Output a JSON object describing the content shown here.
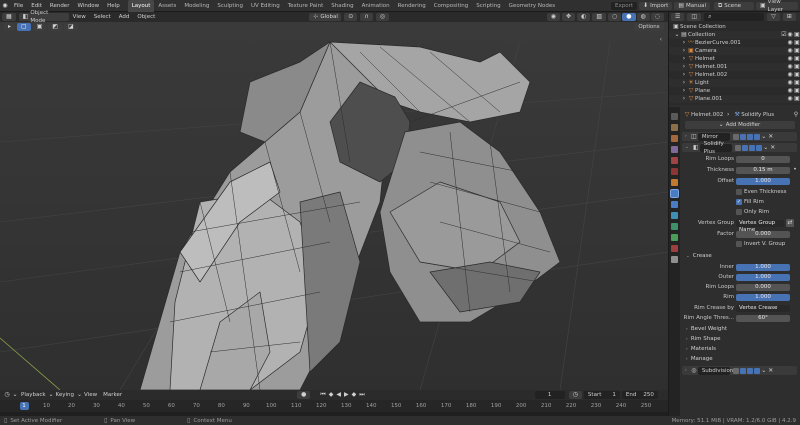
{
  "topbar": {
    "menus": [
      "File",
      "Edit",
      "Render",
      "Window",
      "Help"
    ],
    "workspaces": [
      "Layout",
      "Assets",
      "Modeling",
      "Sculpting",
      "UV Editing",
      "Texture Paint",
      "Shading",
      "Animation",
      "Rendering",
      "Compositing",
      "Scripting",
      "Geometry Nodes"
    ],
    "active_workspace": "Layout",
    "export_label": "Export",
    "import_label": "Import",
    "manual_label": "Manual",
    "scene": "Scene",
    "view_layer": "View Layer"
  },
  "viewport_header": {
    "mode": "Object Mode",
    "menus": [
      "View",
      "Select",
      "Add",
      "Object"
    ],
    "orientation": "Global",
    "options_label": "Options"
  },
  "outliner": {
    "root": "Scene Collection",
    "collection": "Collection",
    "items": [
      "BezierCurve.001",
      "Camera",
      "Helmet",
      "Helmet.001",
      "Helmet.002",
      "Light",
      "Plane",
      "Plane.001"
    ]
  },
  "properties": {
    "object_name": "Helmet.002",
    "modifier_name": "Solidify Plus",
    "add_modifier": "Add Modifier",
    "mirror_label": "Mirror",
    "solidify_label": "Solidify Plus",
    "rows": {
      "rim_loops": {
        "label": "Rim Loops",
        "value": "0"
      },
      "thickness": {
        "label": "Thickness",
        "value": "0.15 m"
      },
      "offset": {
        "label": "Offset",
        "value": "1.000"
      },
      "even_thickness": "Even Thickness",
      "fill_rim": "Fill Rim",
      "only_rim": "Only Rim",
      "vertex_group": {
        "label": "Vertex Group",
        "value": "Vertex Group Name"
      },
      "factor": {
        "label": "Factor",
        "value": "0.000"
      },
      "invert": "Invert V. Group"
    },
    "crease": {
      "title": "Crease",
      "inner": {
        "label": "Inner",
        "value": "1.000"
      },
      "outer": {
        "label": "Outer",
        "value": "1.000"
      },
      "rim_loops": {
        "label": "Rim Loops",
        "value": "0.000"
      },
      "rim": {
        "label": "Rim",
        "value": "1.000"
      },
      "rim_crease_by": {
        "label": "Rim Crease by",
        "value": "Vertex Crease"
      },
      "rim_angle": {
        "label": "Rim Angle Thres...",
        "value": "60°"
      }
    },
    "subpanels": [
      "Bevel Weight",
      "Rim Shape",
      "Materials",
      "Manage"
    ],
    "subdivision_label": "Subdivision"
  },
  "timeline": {
    "menus": [
      "Playback",
      "Keying",
      "View",
      "Marker"
    ],
    "current_frame": "1",
    "start_label": "Start",
    "start_value": "1",
    "end_label": "End",
    "end_value": "250",
    "ticks": [
      "1",
      "10",
      "20",
      "30",
      "40",
      "50",
      "60",
      "70",
      "80",
      "90",
      "100",
      "110",
      "120",
      "130",
      "140",
      "150",
      "160",
      "170",
      "180",
      "190",
      "200",
      "210",
      "220",
      "230",
      "240",
      "250"
    ]
  },
  "status": {
    "left": "Set Active Modifier",
    "mid": "Pan View",
    "right_ctx": "Context Menu",
    "memory": "Memory: 51.1 MiB | VRAM: 1.2/6.0 GiB | 4.2.9"
  }
}
